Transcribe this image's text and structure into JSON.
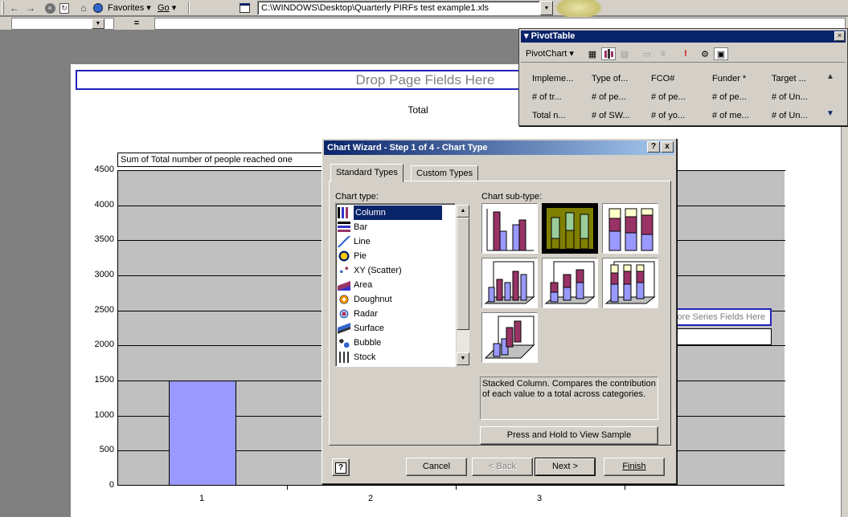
{
  "toolbar": {
    "favorites_label": "Favorites",
    "go_label": "Go",
    "address": "C:\\WINDOWS\\Desktop\\Quarterly PIRFs test example1.xls"
  },
  "formula_bar": {
    "equals": "="
  },
  "sheet": {
    "drop_page_fields": "Drop Page Fields Here",
    "total_label": "Total",
    "data_field_label": "Sum of Total number of people reached one",
    "drop_series_fields": "Drop More Series Fields Here"
  },
  "chart_data": {
    "type": "bar",
    "categories": [
      "1",
      "2",
      "3"
    ],
    "values": [
      1500
    ],
    "ylim": [
      0,
      4500
    ],
    "yticks": [
      0,
      500,
      1000,
      1500,
      2000,
      2500,
      3000,
      3500,
      4000,
      4500
    ],
    "series_color": "#9999ff",
    "plot_background": "#c0c0c0",
    "grid": true
  },
  "pivot_toolbar": {
    "title": "PivotTable",
    "pivotchart_label": "PivotChart",
    "fields": [
      [
        "Impleme...",
        "Type of...",
        "FCO#",
        "Funder *",
        "Target ..."
      ],
      [
        "# of tr...",
        "# of pe...",
        "# of pe...",
        "# of pe...",
        "# of Un..."
      ],
      [
        "Total n...",
        "# of SW...",
        "# of yo...",
        "# of me...",
        "# of Un..."
      ]
    ]
  },
  "wizard": {
    "title": "Chart Wizard - Step 1 of 4 - Chart Type",
    "help_btn": "?",
    "close_btn": "x",
    "tabs": [
      "Standard Types",
      "Custom Types"
    ],
    "chart_type_label": "Chart type:",
    "chart_subtype_label": "Chart sub-type:",
    "chart_types": [
      "Column",
      "Bar",
      "Line",
      "Pie",
      "XY (Scatter)",
      "Area",
      "Doughnut",
      "Radar",
      "Surface",
      "Bubble",
      "Stock"
    ],
    "selected_type": "Column",
    "subtype_description": "Stacked Column. Compares the contribution of each value to a total across categories.",
    "view_sample_label": "Press and Hold to View Sample",
    "buttons": {
      "cancel": "Cancel",
      "back": "< Back",
      "next": "Next >",
      "finish": "Finish"
    }
  },
  "colors": {
    "accent_blue": "#0a246a",
    "bar": "#9999ff",
    "bar_dark": "#993366",
    "bar_light": "#ffffcc",
    "bar_green": "#808000",
    "bar_teal": "#99cc99"
  }
}
